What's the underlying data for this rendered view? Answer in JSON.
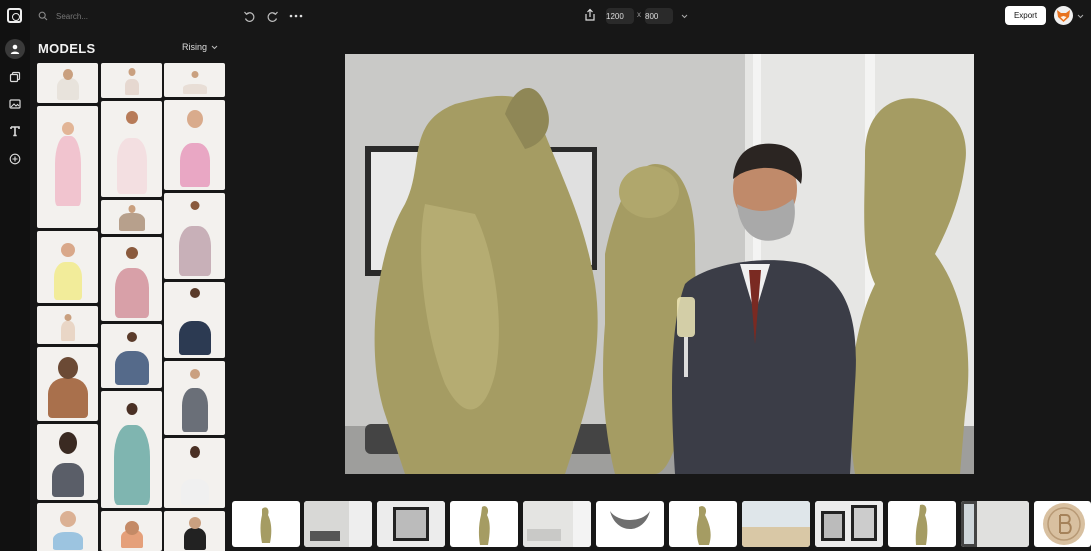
{
  "search": {
    "placeholder": "Search..."
  },
  "sidebar": {
    "title": "MODELS",
    "sort_label": "Rising"
  },
  "rail": {
    "items": [
      "models",
      "layers",
      "images",
      "text",
      "add"
    ]
  },
  "toolbar": {
    "width": "1200",
    "times": "x",
    "height": "800",
    "export_label": "Export"
  },
  "colors": {
    "background": "#171717",
    "accent": "#ffffff",
    "alien_skin": "#a49a62",
    "suit": "#3b3d47"
  }
}
